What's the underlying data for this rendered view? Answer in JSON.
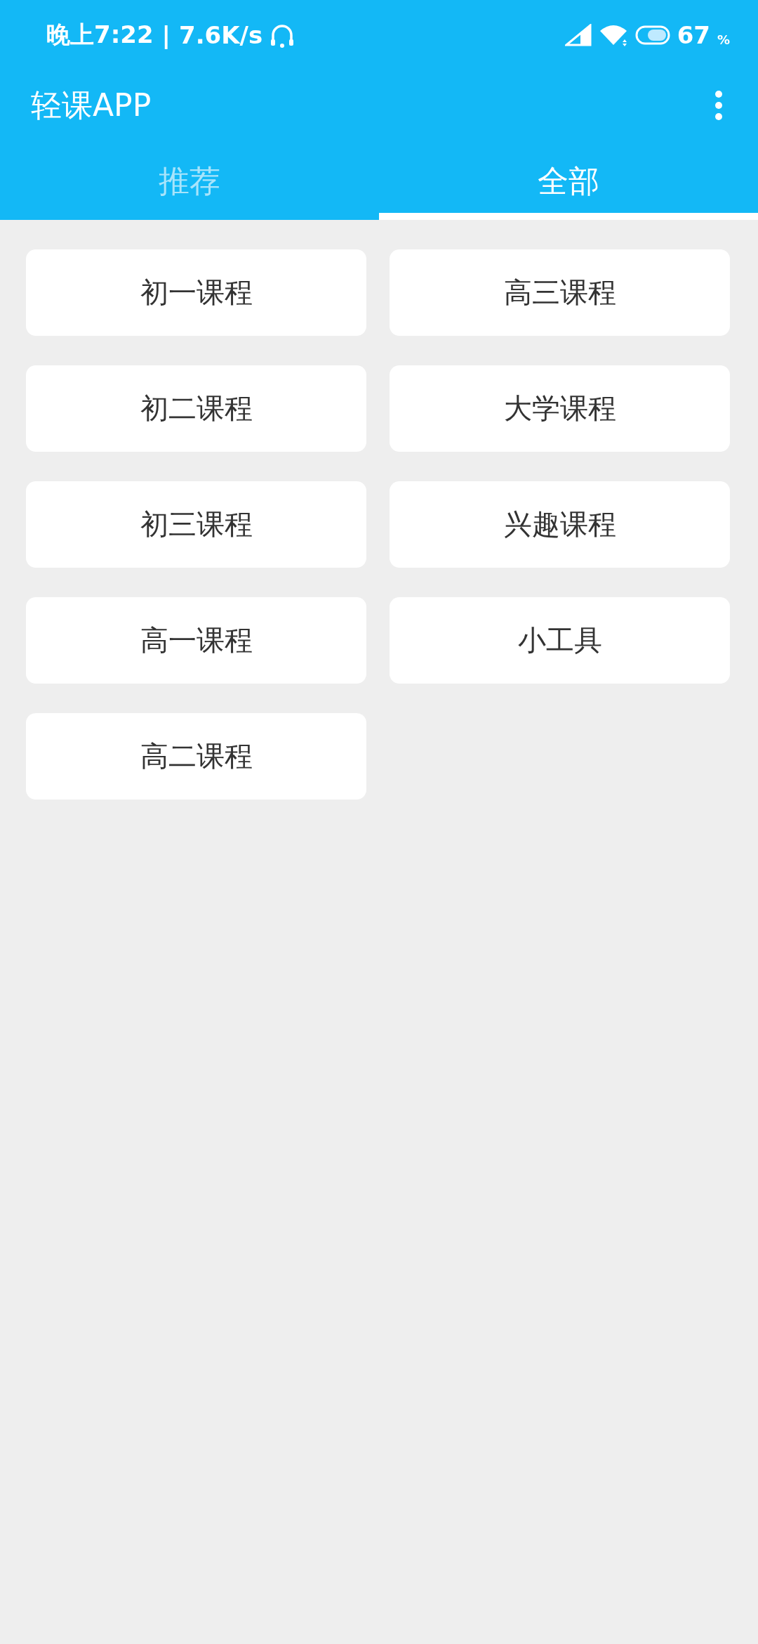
{
  "status_bar": {
    "time": "晚上7:22",
    "separator": "|",
    "speed": "7.6K/s",
    "battery": "67",
    "percent": "%"
  },
  "app_bar": {
    "title": "轻课APP"
  },
  "tabs": [
    {
      "label": "推荐",
      "selected": false
    },
    {
      "label": "全部",
      "selected": true
    }
  ],
  "courses": [
    "初一课程",
    "高三课程",
    "初二课程",
    "大学课程",
    "初三课程",
    "兴趣课程",
    "高一课程",
    "小工具",
    "高二课程"
  ]
}
